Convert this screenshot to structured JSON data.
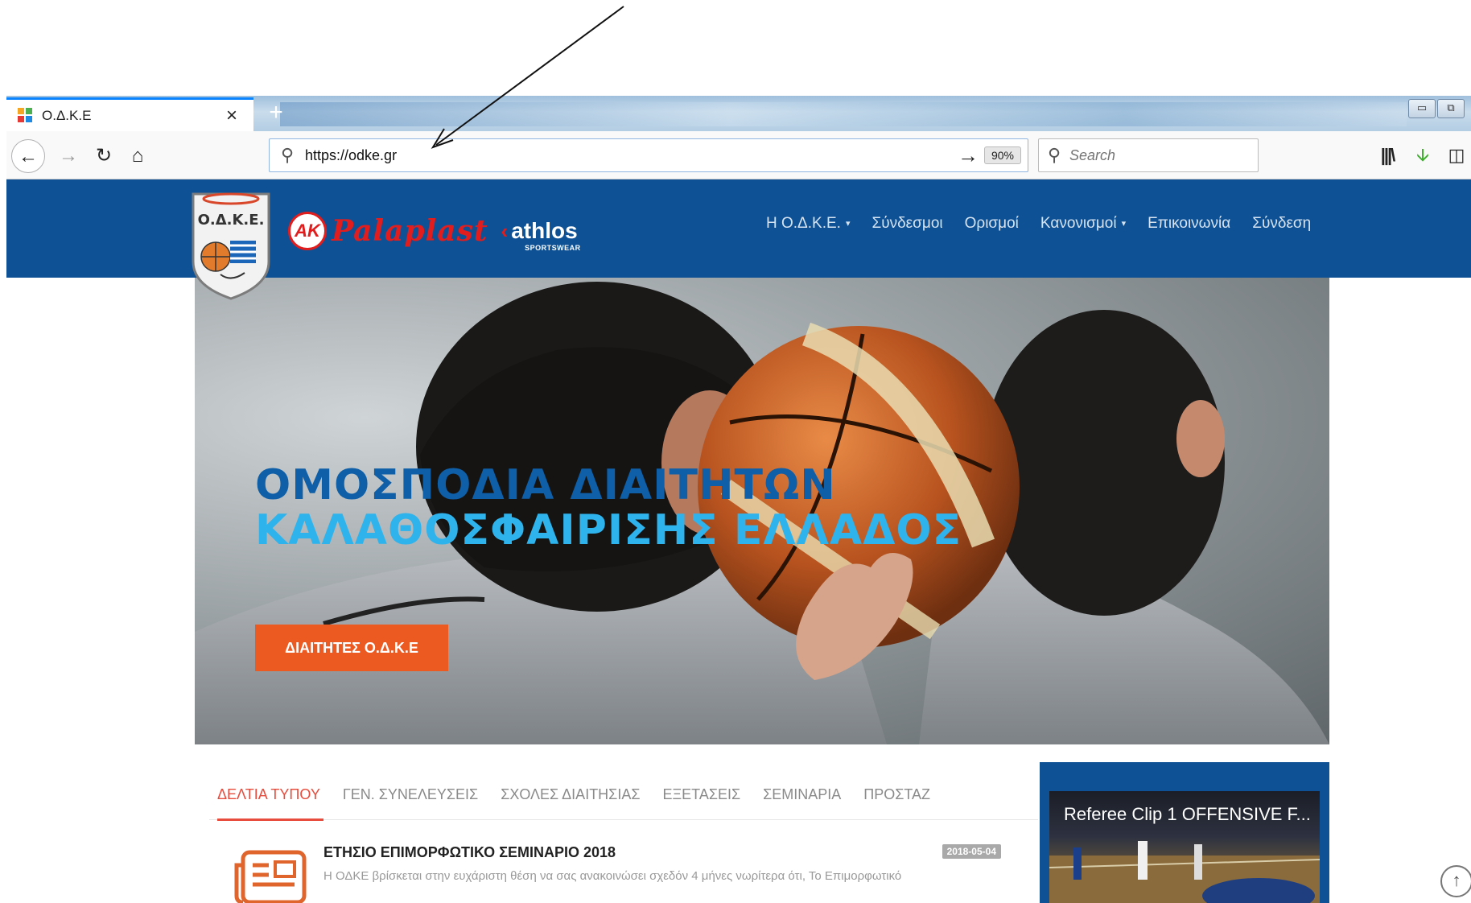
{
  "browser": {
    "tab_title": "Ο.Δ.Κ.Ε",
    "tab_close": "×",
    "new_tab": "+",
    "url": "https://odke.gr",
    "zoom": "90%",
    "search_placeholder": "Search",
    "window_controls": [
      "▭",
      "⧉"
    ]
  },
  "site": {
    "logo_text": "Ο.Δ.Κ.Ε.",
    "sponsors": {
      "ak": "AK",
      "palaplast": "Palaplast",
      "athlos": "athlos",
      "athlos_sub": "SPORTSWEAR"
    },
    "nav": [
      {
        "label": "Η Ο.Δ.Κ.Ε.",
        "dropdown": true
      },
      {
        "label": "Σύνδεσμοι",
        "dropdown": false
      },
      {
        "label": "Ορισμοί",
        "dropdown": false
      },
      {
        "label": "Κανονισμοί",
        "dropdown": true
      },
      {
        "label": "Επικοινωνία",
        "dropdown": false
      },
      {
        "label": "Σύνδεση",
        "dropdown": false
      }
    ]
  },
  "hero": {
    "line1": "ΟΜΟΣΠΟΔΙΑ ΔΙΑΙΤΗΤΩΝ",
    "line2": "ΚΑΛΑΘΟΣΦΑΙΡΙΣΗΣ ΕΛΛΑΔΟΣ",
    "cta": "ΔΙΑΙΤΗΤΕΣ Ο.Δ.Κ.Ε"
  },
  "news": {
    "tabs": [
      {
        "label": "ΔΕΛΤΙΑ ΤΥΠΟΥ",
        "active": true
      },
      {
        "label": "ΓΕΝ. ΣΥΝΕΛΕΥΣΕΙΣ",
        "active": false
      },
      {
        "label": "ΣΧΟΛΕΣ ΔΙΑΙΤΗΣΙΑΣ",
        "active": false
      },
      {
        "label": "ΕΞΕΤΑΣΕΙΣ",
        "active": false
      },
      {
        "label": "ΣΕΜΙΝΑΡΙΑ",
        "active": false
      },
      {
        "label": "ΠΡΟΣΤΑΖ",
        "active": false
      }
    ],
    "article": {
      "title": "ΕΤΗΣΙΟ ΕΠΙΜΟΡΦΩΤΙΚΟ ΣΕΜΙΝΑΡΙΟ 2018",
      "date": "2018-05-04",
      "excerpt": "Η ΟΔΚΕ βρίσκεται στην ευχάριστη θέση να σας ανακοινώσει σχεδόν 4 μήνες νωρίτερα ότι, Το Επιμορφωτικό"
    }
  },
  "video": {
    "title": "Referee Clip 1 OFFENSIVE F..."
  },
  "scroll_top": "↑",
  "colors": {
    "header_blue": "#0e5195",
    "cta_orange": "#ec5a21",
    "title_dark_blue": "#0e5fa8",
    "title_light_blue": "#2fb3ec",
    "active_tab_red": "#e74c3c"
  }
}
